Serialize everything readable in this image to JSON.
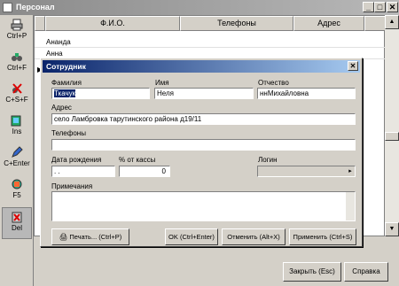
{
  "window": {
    "title": "Персонал",
    "minimize": "_",
    "maximize": "□",
    "close": "✕"
  },
  "toolbar": [
    {
      "label": "Ctrl+P",
      "icon": "print-icon"
    },
    {
      "label": "Ctrl+F",
      "icon": "binoculars-icon"
    },
    {
      "label": "C+S+F",
      "icon": "clear-filter-icon"
    },
    {
      "label": "Ins",
      "icon": "add-record-icon"
    },
    {
      "label": "C+Enter",
      "icon": "edit-record-icon"
    },
    {
      "label": "F5",
      "icon": "refresh-icon"
    },
    {
      "label": "Del",
      "icon": "delete-record-icon"
    }
  ],
  "table": {
    "columns": [
      "Ф.И.О.",
      "Телефоны",
      "Адрес"
    ],
    "rows": [
      "Ананда",
      "Анна"
    ]
  },
  "buttons": {
    "close": "Закрыть (Esc)",
    "help": "Справка"
  },
  "dialog": {
    "title": "Сотрудник",
    "close": "✕",
    "labels": {
      "surname": "Фамилия",
      "name": "Имя",
      "patronymic": "Отчество",
      "address": "Адрес",
      "phones": "Телефоны",
      "birthdate": "Дата рождения",
      "cash_percent": "% от кассы",
      "login": "Логин",
      "notes": "Примечания"
    },
    "values": {
      "surname": "Ткачук",
      "name": "Неля",
      "patronymic": "ннМихайловна",
      "address": "село Ламбровка тарутинского района д19/11",
      "phones": "",
      "birthdate": " . .",
      "cash_percent": "0",
      "login": ""
    },
    "buttons": {
      "print": "Печать... (Ctrl+P)",
      "ok": "OK (Ctrl+Enter)",
      "cancel": "Отменить (Alt+X)",
      "apply": "Применить (Ctrl+S)"
    }
  }
}
